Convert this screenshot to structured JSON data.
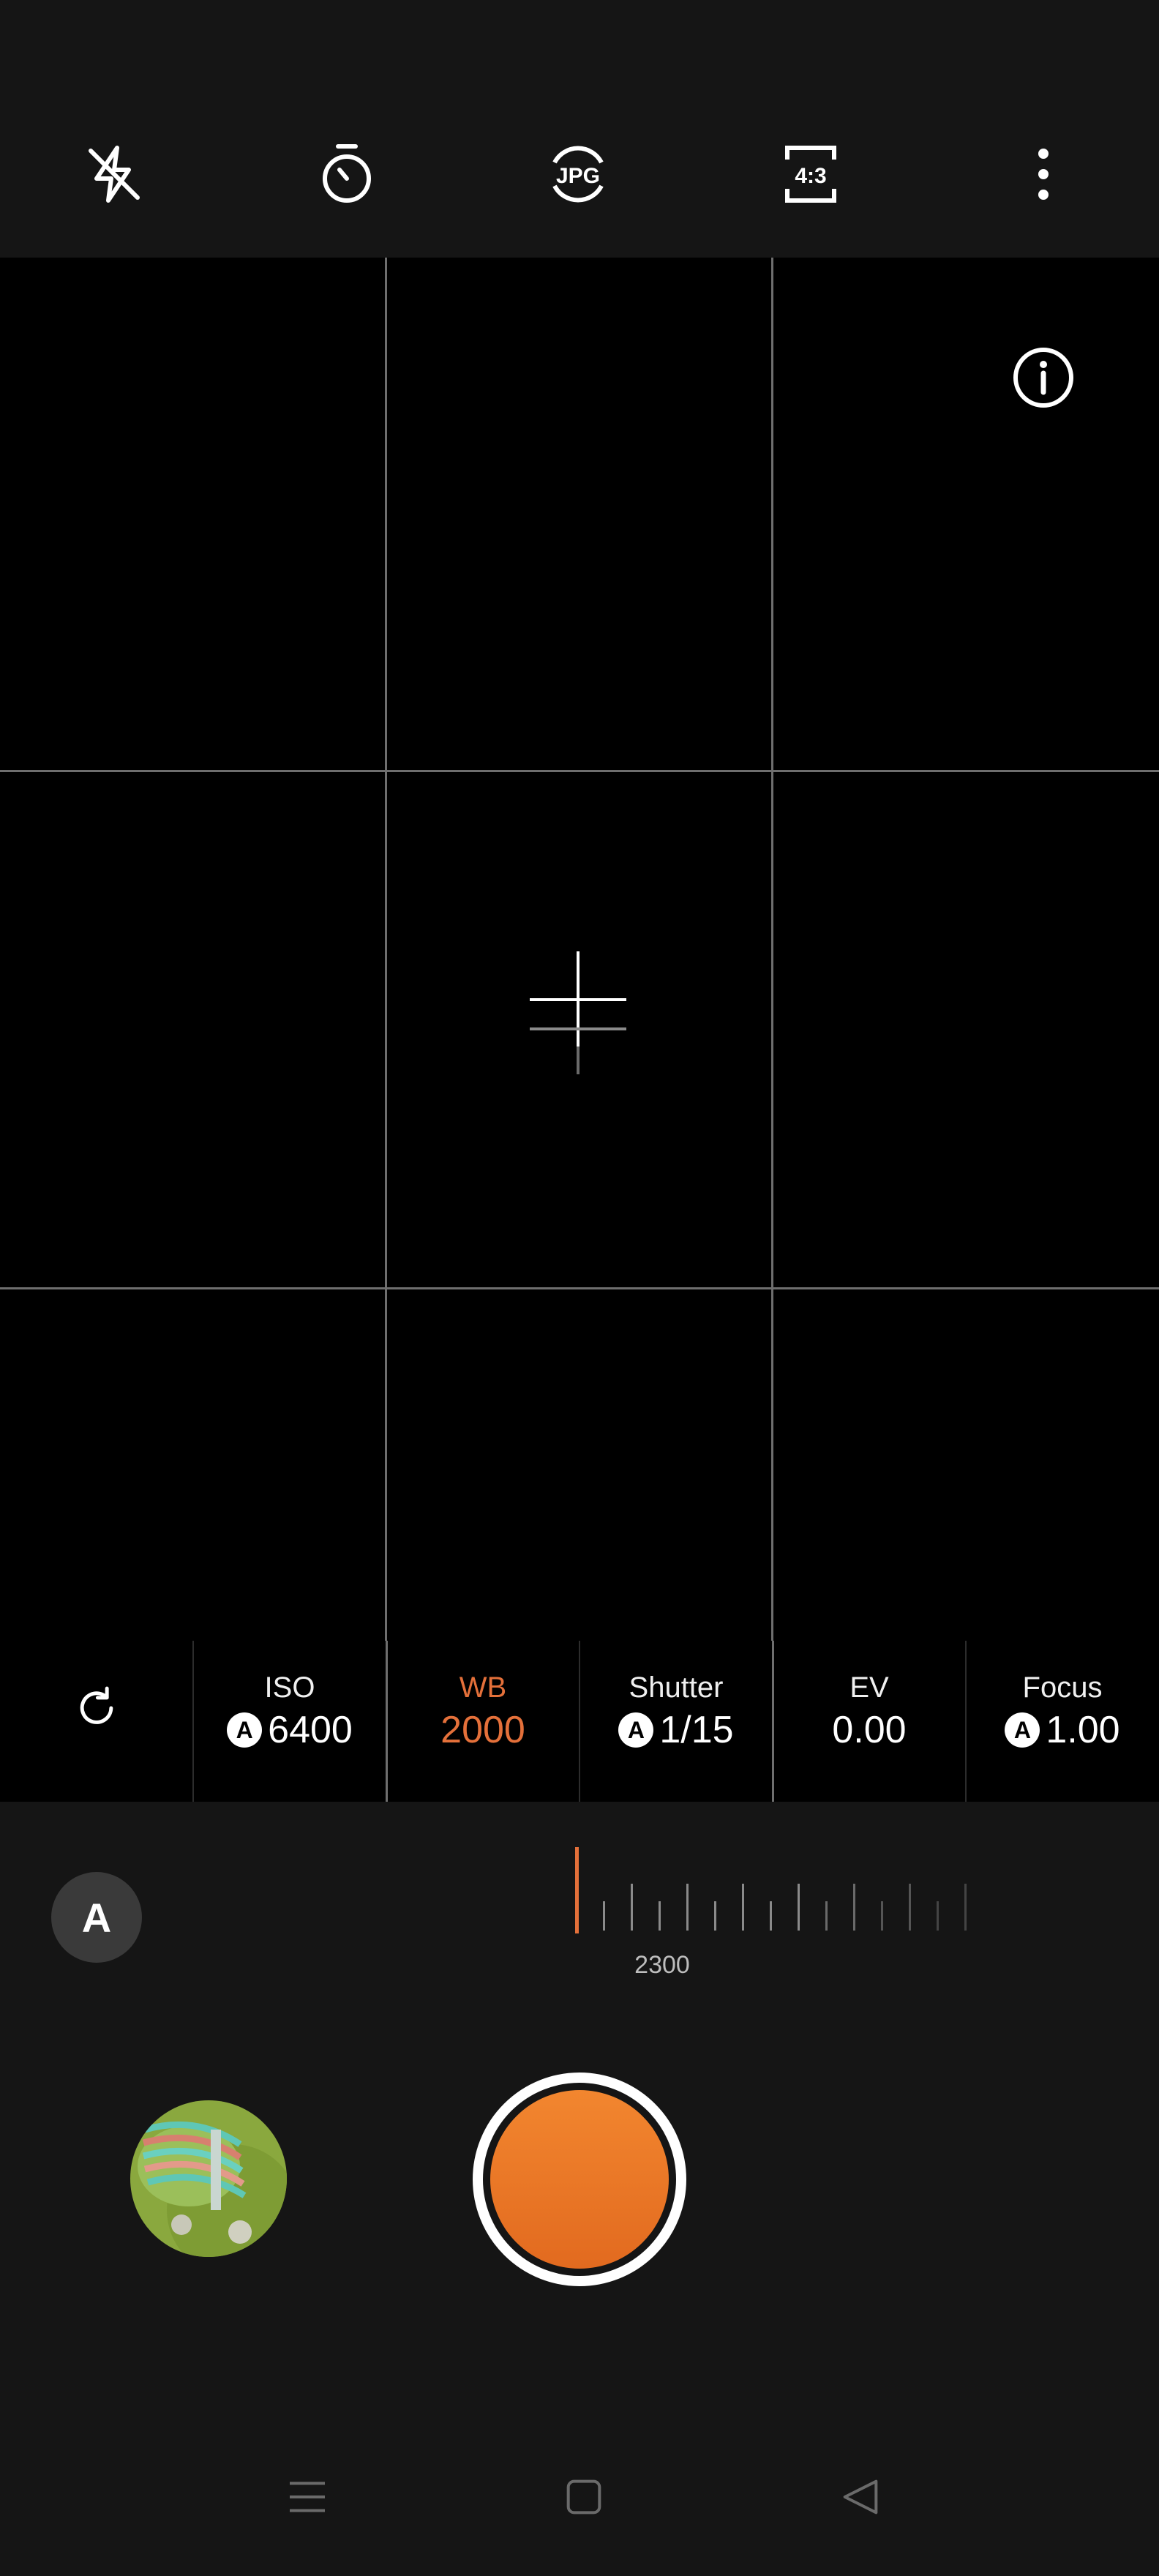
{
  "top_bar": {
    "icons": [
      "flash-off-icon",
      "timer-icon",
      "jpg-format-icon",
      "aspect-ratio-icon",
      "more-options-icon"
    ],
    "format_label": "JPG",
    "aspect_label": "4:3"
  },
  "viewfinder": {
    "grid": true,
    "info_icon": "info-icon"
  },
  "params": {
    "reset_icon": "refresh-icon",
    "iso": {
      "label": "ISO",
      "value": "6400",
      "auto_badge": "A"
    },
    "wb": {
      "label": "WB",
      "value": "2000"
    },
    "shutter": {
      "label": "Shutter",
      "value": "1/15",
      "auto_badge": "A"
    },
    "ev": {
      "label": "EV",
      "value": "0.00"
    },
    "focus": {
      "label": "Focus",
      "value": "1.00",
      "auto_badge": "A"
    }
  },
  "dial": {
    "auto_label": "A",
    "value_label": "2300"
  },
  "bottom": {
    "gallery_thumbnail": "gallery-thumbnail",
    "shutter": "shutter-button"
  },
  "colors": {
    "accent": "#e4703a",
    "background": "#151515"
  }
}
